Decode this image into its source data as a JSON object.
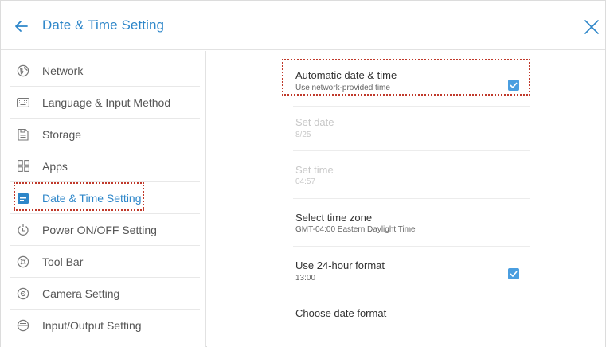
{
  "header": {
    "title": "Date & Time Setting",
    "back_icon": "back-arrow-icon",
    "close_icon": "close-icon"
  },
  "colors": {
    "accent": "#2d86c9",
    "checkbox": "#4a9ee0",
    "highlight_border": "#c0392b"
  },
  "sidebar": {
    "items": [
      {
        "label": "Network",
        "icon": "globe-icon",
        "active": false
      },
      {
        "label": "Language & Input Method",
        "icon": "keyboard-icon",
        "active": false
      },
      {
        "label": "Storage",
        "icon": "storage-icon",
        "active": false
      },
      {
        "label": "Apps",
        "icon": "apps-grid-icon",
        "active": false
      },
      {
        "label": "Date & Time Setting",
        "icon": "calendar-icon",
        "active": true
      },
      {
        "label": "Power ON/OFF Setting",
        "icon": "power-icon",
        "active": false
      },
      {
        "label": "Tool Bar",
        "icon": "toolbar-icon",
        "active": false
      },
      {
        "label": "Camera Setting",
        "icon": "camera-icon",
        "active": false
      },
      {
        "label": "Input/Output Setting",
        "icon": "input-output-icon",
        "active": false
      }
    ]
  },
  "settings": {
    "auto_datetime": {
      "title": "Automatic date & time",
      "subtitle": "Use network-provided time",
      "checked": true
    },
    "set_date": {
      "title": "Set date",
      "subtitle": "8/25",
      "disabled": true
    },
    "set_time": {
      "title": "Set time",
      "subtitle": "04:57",
      "disabled": true
    },
    "time_zone": {
      "title": "Select time zone",
      "subtitle": "GMT-04:00 Eastern Daylight Time"
    },
    "hour_format": {
      "title": "Use 24-hour format",
      "subtitle": "13:00",
      "checked": true
    },
    "date_format": {
      "title": "Choose date format"
    }
  }
}
